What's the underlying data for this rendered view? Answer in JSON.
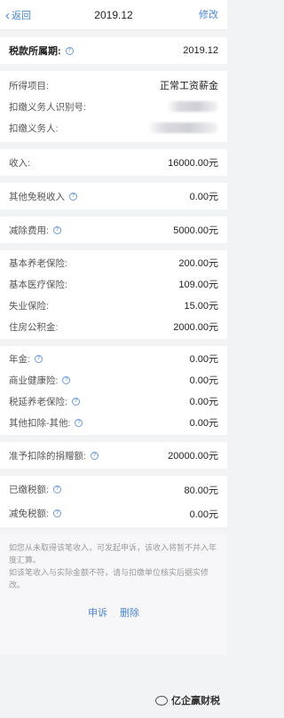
{
  "nav": {
    "back": "返回",
    "title": "2019.12",
    "action": "修改"
  },
  "period": {
    "label": "税款所属期:",
    "value": "2019.12"
  },
  "income_info": [
    {
      "label": "所得项目:",
      "value": "正常工资薪金"
    },
    {
      "label": "扣缴义务人识别号:",
      "value": ""
    },
    {
      "label": "扣缴义务人:",
      "value": ""
    }
  ],
  "income": {
    "label": "收入:",
    "value": "16000.00元"
  },
  "other_exempt": {
    "label": "其他免税收入",
    "value": "0.00元"
  },
  "deduction_fee": {
    "label": "减除费用:",
    "value": "5000.00元"
  },
  "insurance": [
    {
      "label": "基本养老保险:",
      "value": "200.00元"
    },
    {
      "label": "基本医疗保险:",
      "value": "109.00元"
    },
    {
      "label": "失业保险:",
      "value": "15.00元"
    },
    {
      "label": "住房公积金:",
      "value": "2000.00元"
    }
  ],
  "other_deductions": [
    {
      "label": "年金:",
      "value": "0.00元"
    },
    {
      "label": "商业健康险:",
      "value": "0.00元"
    },
    {
      "label": "税延养老保险:",
      "value": "0.00元"
    },
    {
      "label": "其他扣除-其他:",
      "value": "0.00元"
    }
  ],
  "donation": {
    "label": "准予扣除的捐赠额:",
    "value": "20000.00元"
  },
  "tax": [
    {
      "label": "已缴税额:",
      "value": "80.00元"
    },
    {
      "label": "减免税额:",
      "value": "0.00元"
    }
  ],
  "notice": {
    "line1": "如您从未取得该笔收入，可发起申诉，该收入将暂不并入年度汇算。",
    "line2": "如该笔收入与实际金额不符，请与扣缴单位核实后据实修改。"
  },
  "actions": {
    "appeal": "申诉",
    "delete": "删除"
  },
  "watermark": {
    "text": "亿企赢财税"
  },
  "colors": {
    "accent": "#4a86d9",
    "background": "#f2f3f5"
  }
}
